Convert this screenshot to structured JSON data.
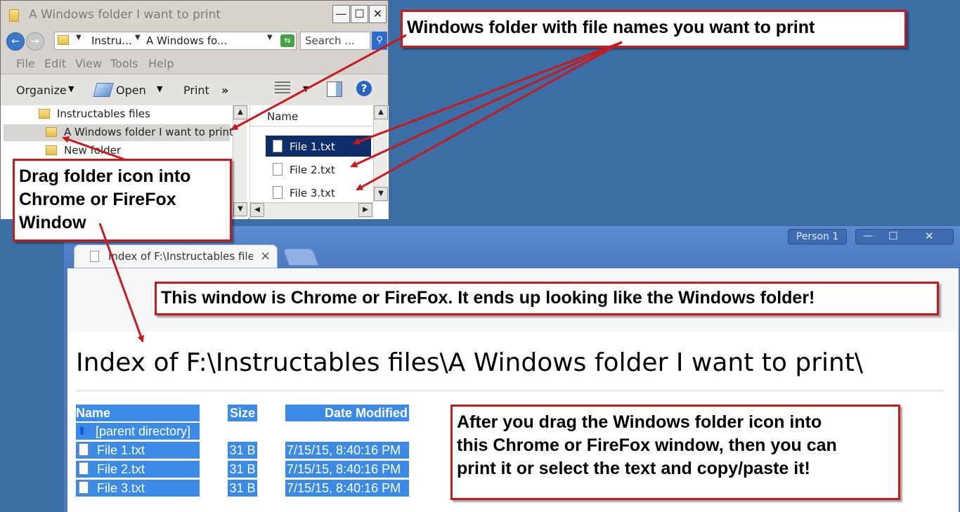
{
  "explorer": {
    "title": "A Windows folder I want to print",
    "title_buttons": [
      "—",
      "☐",
      "✕"
    ],
    "address_crumbs": [
      "Instru...",
      "A Windows fo..."
    ],
    "search_placeholder": "Search ...",
    "menu": [
      "File",
      "Edit",
      "View",
      "Tools",
      "Help"
    ],
    "toolbar": {
      "organize": "Organize",
      "open": "Open",
      "print": "Print",
      "more": "»"
    },
    "tree": [
      "Instructables files",
      "A Windows folder I want to print",
      "New folder"
    ],
    "list_header": "Name",
    "files": [
      "File 1.txt",
      "File 2.txt",
      "File 3.txt"
    ]
  },
  "chrome": {
    "profile": "Person 1",
    "tab_title": "Index of F:\\Instructables file",
    "tab_close": "×",
    "window_buttons": [
      "—",
      "☐",
      "✕"
    ],
    "page_title": "Index of F:\\Instructables files\\A Windows folder I want to print\\",
    "columns": {
      "name": "Name",
      "size": "Size",
      "date": "Date Modified"
    },
    "parent": "[parent directory]",
    "rows": [
      {
        "name": "File 1.txt",
        "size": "31 B",
        "date": "7/15/15, 8:40:16 PM"
      },
      {
        "name": "File 2.txt",
        "size": "31 B",
        "date": "7/15/15, 8:40:16 PM"
      },
      {
        "name": "File 3.txt",
        "size": "31 B",
        "date": "7/15/15, 8:40:16 PM"
      }
    ]
  },
  "annotations": {
    "folder_note": "Windows folder with file names you want to print",
    "drag_note_lines": [
      "Drag folder icon into",
      "Chrome or FireFox",
      "Window"
    ],
    "chrome_note": "This window is Chrome or FireFox.  It ends up looking like the Windows folder!",
    "after_note_lines": [
      "After you drag the Windows folder icon into",
      "this Chrome or FireFox window, then you can",
      "print it or select the text and copy/paste it!"
    ]
  },
  "colors": {
    "desktop": "#3a6ea5",
    "annotation_border": "#c8191f",
    "selection": "#3b8be6",
    "chrome_frame": "#4f7cbf"
  }
}
